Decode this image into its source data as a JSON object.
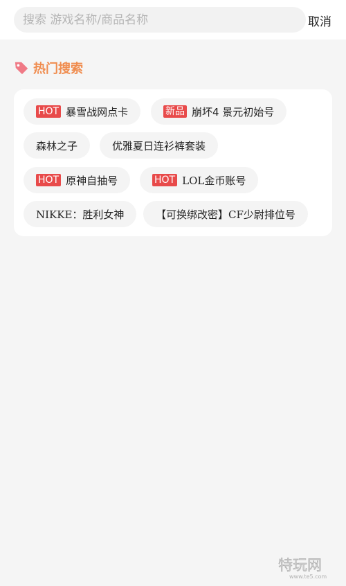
{
  "search": {
    "placeholder": "搜索 游戏名称/商品名称",
    "cancel_label": "取消"
  },
  "hot_section": {
    "title": "热门搜索",
    "accent_color": "#f08c4e",
    "badge_color": "#e84a4a",
    "items": [
      {
        "badge": "HOT",
        "label": "暴雪战网点卡"
      },
      {
        "badge": "新品",
        "label": "崩坏4 景元初始号"
      },
      {
        "badge": "",
        "label": "森林之子"
      },
      {
        "badge": "",
        "label": "优雅夏日连衫裤套装"
      },
      {
        "badge": "HOT",
        "label": "原神自抽号"
      },
      {
        "badge": "HOT",
        "label": "LOL金币账号"
      },
      {
        "badge": "",
        "label": "NIKKE：胜利女神"
      },
      {
        "badge": "",
        "label": "【可换绑改密】CF少尉排位号"
      }
    ]
  },
  "watermark": {
    "icon": "brand-logo",
    "text": "特玩网",
    "url_text": "www.te5.com"
  }
}
